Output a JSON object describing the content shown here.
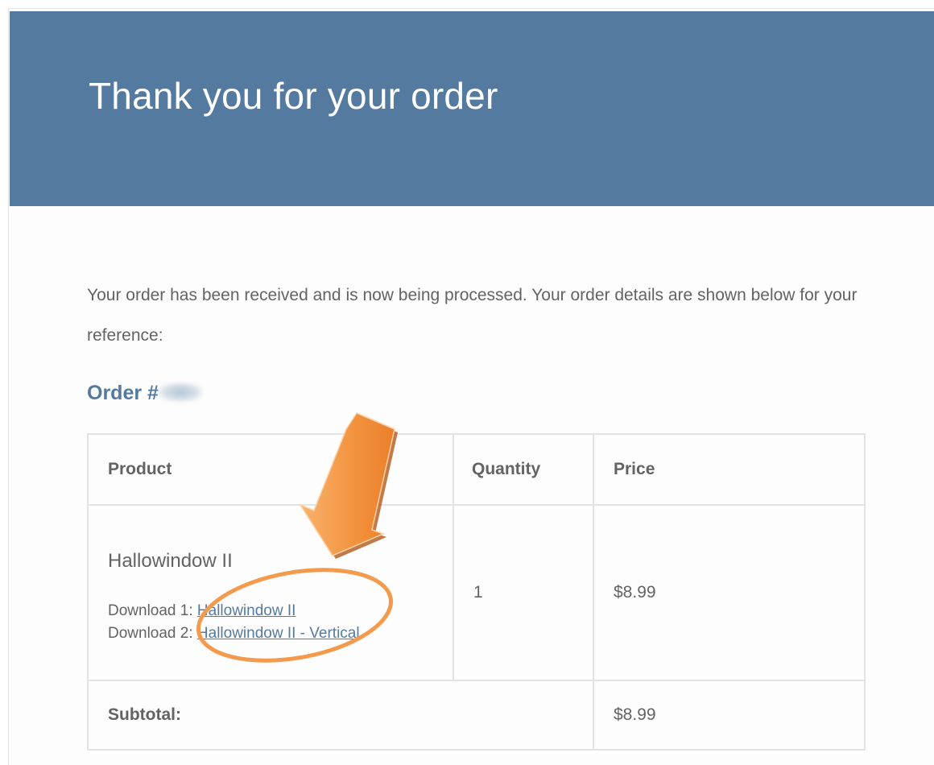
{
  "header": {
    "title": "Thank you for your order"
  },
  "intro": {
    "text": "Your order has been received and is now being processed. Your order details are shown below for your reference:"
  },
  "order": {
    "title_prefix": "Order #"
  },
  "table": {
    "headers": {
      "product": "Product",
      "quantity": "Quantity",
      "price": "Price"
    },
    "item": {
      "name": "Hallowindow II",
      "quantity": "1",
      "price": "$8.99",
      "downloads": [
        {
          "label": "Download 1: ",
          "link": "Hallowindow II"
        },
        {
          "label": "Download 2: ",
          "link": "Hallowindow II - Vertical"
        }
      ]
    },
    "subtotal": {
      "label": "Subtotal:",
      "value": "$8.99"
    }
  },
  "colors": {
    "header_bg": "#557a9f",
    "accent": "#557a9f",
    "annotation": "#f39a4c"
  },
  "annotation": {
    "arrow_icon": "down-left-arrow",
    "highlight_shape": "ellipse"
  }
}
